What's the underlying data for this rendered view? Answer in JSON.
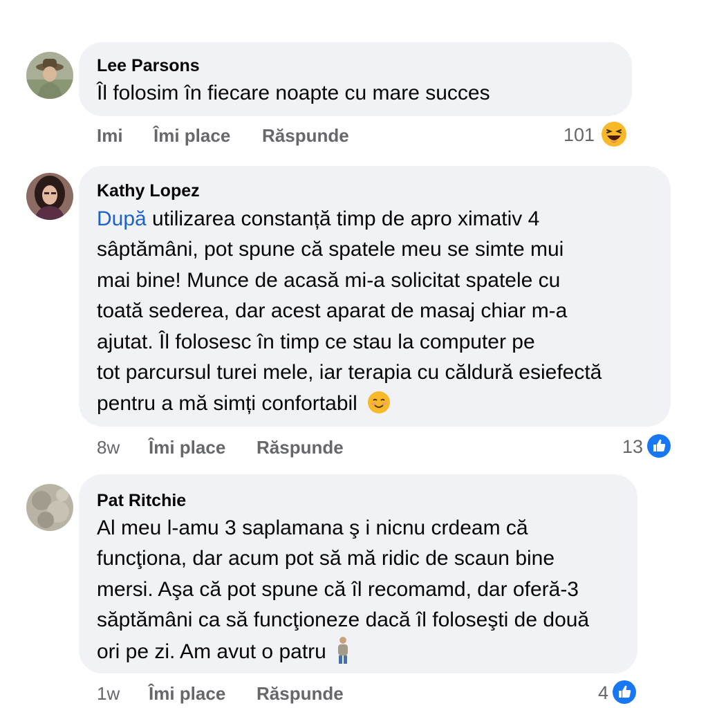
{
  "comments": [
    {
      "author": "Lee Parsons",
      "lines": [
        "Îl folosim în fiecare noapte cu mare succes"
      ],
      "time": "Imi",
      "like_label": "Îmi place",
      "reply_label": "Răspunde",
      "reaction_count": "101",
      "reaction_icon": "haha-emoji-icon"
    },
    {
      "author": "Kathy Lopez",
      "link_word": "După",
      "lines": [
        " utilizarea constanță timp de apro ximativ 4",
        "sâptămâni, pot spune că spatele meu se simte mui",
        "mai bine! Munce de acasă mi-a solicitat spatele cu",
        "toată sederea, dar acest aparat de masaj chiar m-a",
        "ajutat. Îl folosesc în timp ce stau la computer pe",
        "tot parcursul turei mele, iar terapia cu căldură esiefectă",
        "pentru a mă simți confortabil"
      ],
      "time": "8w",
      "like_label": "Îmi place",
      "reply_label": "Răspunde",
      "reaction_count": "13",
      "reaction_icon": "like-thumb-icon"
    },
    {
      "author": "Pat Ritchie",
      "lines": [
        "Al meu l-amu 3 saplamana ş i nicnu crdeam că",
        "funcţiona, dar acum pot să mă ridic de scaun bine",
        "mersi. Aşa că pot spune că îl recomamd, dar oferă-3",
        "săptămâni ca să funcţioneze dacă îl foloseşti de două",
        "ori pe zi. Am avut o patru"
      ],
      "time": "1w",
      "like_label": "Îmi place",
      "reply_label": "Răspunde",
      "reaction_count": "4",
      "reaction_icon": "like-thumb-icon"
    }
  ],
  "colors": {
    "bubble": "#f0f2f5",
    "meta": "#65676b",
    "link": "#1b63c8",
    "like_blue": "#1877f2"
  }
}
